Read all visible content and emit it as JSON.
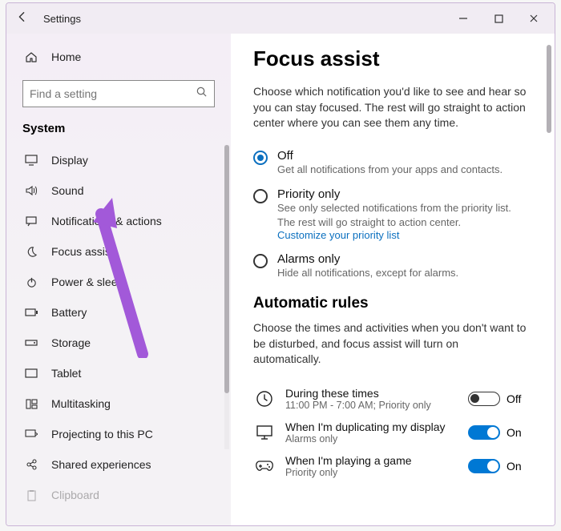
{
  "titlebar": {
    "title": "Settings"
  },
  "sidebar": {
    "home": "Home",
    "search_placeholder": "Find a setting",
    "category": "System",
    "items": [
      {
        "label": "Display"
      },
      {
        "label": "Sound"
      },
      {
        "label": "Notifications & actions"
      },
      {
        "label": "Focus assist"
      },
      {
        "label": "Power & sleep"
      },
      {
        "label": "Battery"
      },
      {
        "label": "Storage"
      },
      {
        "label": "Tablet"
      },
      {
        "label": "Multitasking"
      },
      {
        "label": "Projecting to this PC"
      },
      {
        "label": "Shared experiences"
      },
      {
        "label": "Clipboard"
      }
    ]
  },
  "main": {
    "title": "Focus assist",
    "intro": "Choose which notification you'd like to see and hear so you can stay focused. The rest will go straight to action center where you can see them any time.",
    "modes": [
      {
        "title": "Off",
        "desc": "Get all notifications from your apps and contacts.",
        "selected": true
      },
      {
        "title": "Priority only",
        "desc": "See only selected notifications from the priority list. The rest will go straight to action center.",
        "link": "Customize your priority list",
        "selected": false
      },
      {
        "title": "Alarms only",
        "desc": "Hide all notifications, except for alarms.",
        "selected": false
      }
    ],
    "rules_heading": "Automatic rules",
    "rules_intro": "Choose the times and activities when you don't want to be disturbed, and focus assist will turn on automatically.",
    "rules": [
      {
        "title": "During these times",
        "sub": "11:00 PM - 7:00 AM; Priority only",
        "on": false,
        "state": "Off"
      },
      {
        "title": "When I'm duplicating my display",
        "sub": "Alarms only",
        "on": true,
        "state": "On"
      },
      {
        "title": "When I'm playing a game",
        "sub": "Priority only",
        "on": true,
        "state": "On"
      }
    ]
  }
}
